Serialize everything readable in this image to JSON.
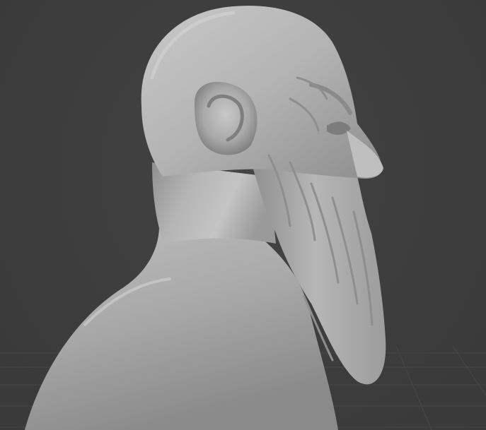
{
  "viewport": {
    "shading_mode": "solid",
    "object": "sculpted-bust",
    "background_color": "#3d3d3d",
    "grid_line_color": "#4a4a4a",
    "mesh_base_color": "#a8a8a8",
    "mesh_highlight_color": "#cfcfcf",
    "mesh_shadow_color": "#6e6e6e"
  }
}
